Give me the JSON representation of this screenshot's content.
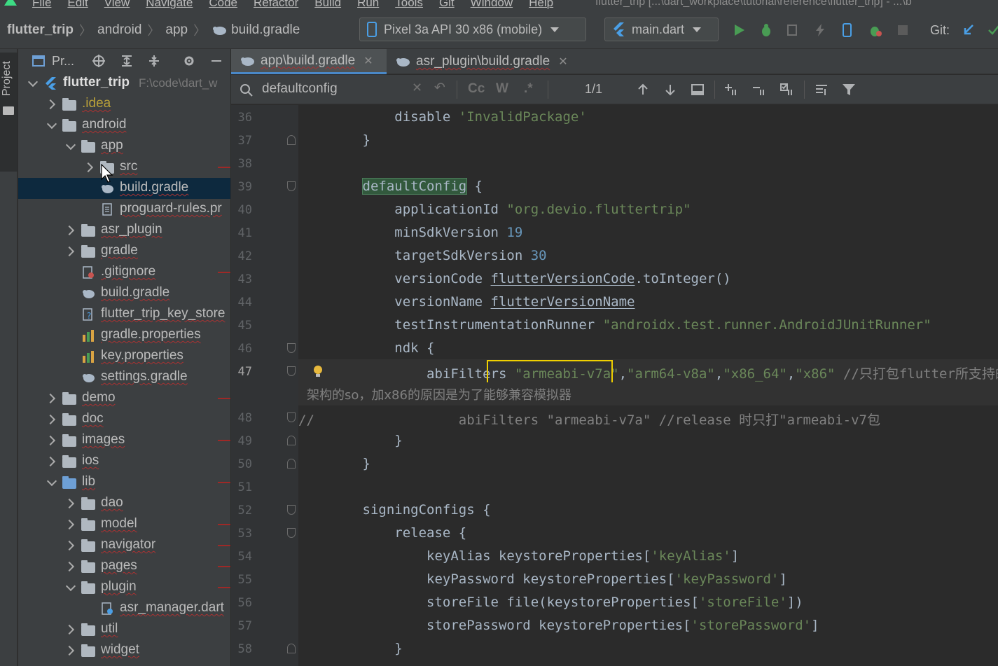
{
  "menubar": {
    "items": [
      "File",
      "Edit",
      "View",
      "Navigate",
      "Code",
      "Refactor",
      "Build",
      "Run",
      "Tools",
      "Git",
      "Window",
      "Help"
    ],
    "window_title": "flutter_trip [...\\dart_workplace\\tutorial\\reference\\flutter_trip] - ...\\b"
  },
  "navbar": {
    "breadcrumb": [
      "flutter_trip",
      "android",
      "app",
      "build.gradle"
    ],
    "device": "Pixel 3a API 30 x86 (mobile)",
    "run_config": "main.dart",
    "git_label": "Git:"
  },
  "toolstrip": {
    "project_tab": "Project"
  },
  "project_panel": {
    "view_label": "Pr...",
    "tree": [
      {
        "label": "flutter_trip",
        "path": "F:\\code\\dart_w",
        "depth": 0,
        "expand": "down",
        "icon": "flutter-project-icon"
      },
      {
        "label": ".idea",
        "depth": 1,
        "expand": "right",
        "icon": "folder-icon"
      },
      {
        "label": "android",
        "depth": 1,
        "expand": "down",
        "icon": "folder-icon"
      },
      {
        "label": "app",
        "depth": 2,
        "expand": "down",
        "icon": "folder-icon"
      },
      {
        "label": "src",
        "depth": 3,
        "expand": "right",
        "icon": "folder-icon"
      },
      {
        "label": "build.gradle",
        "depth": 3,
        "expand": "none",
        "icon": "gradle-icon",
        "selected": true
      },
      {
        "label": "proguard-rules.pr",
        "depth": 3,
        "expand": "none",
        "icon": "file-icon"
      },
      {
        "label": "asr_plugin",
        "depth": 2,
        "expand": "right",
        "icon": "folder-icon"
      },
      {
        "label": "gradle",
        "depth": 2,
        "expand": "right",
        "icon": "folder-icon"
      },
      {
        "label": ".gitignore",
        "depth": 2,
        "expand": "none",
        "icon": "gitignore-icon"
      },
      {
        "label": "build.gradle",
        "depth": 2,
        "expand": "none",
        "icon": "gradle-icon"
      },
      {
        "label": "flutter_trip_key_store",
        "depth": 2,
        "expand": "none",
        "icon": "keystore-icon"
      },
      {
        "label": "gradle.properties",
        "depth": 2,
        "expand": "none",
        "icon": "properties-icon"
      },
      {
        "label": "key.properties",
        "depth": 2,
        "expand": "none",
        "icon": "properties-icon"
      },
      {
        "label": "settings.gradle",
        "depth": 2,
        "expand": "none",
        "icon": "gradle-icon"
      },
      {
        "label": "demo",
        "depth": 1,
        "expand": "right",
        "icon": "folder-icon"
      },
      {
        "label": "doc",
        "depth": 1,
        "expand": "right",
        "icon": "folder-icon"
      },
      {
        "label": "images",
        "depth": 1,
        "expand": "right",
        "icon": "folder-icon"
      },
      {
        "label": "ios",
        "depth": 1,
        "expand": "right",
        "icon": "folder-icon"
      },
      {
        "label": "lib",
        "depth": 1,
        "expand": "down",
        "icon": "folder-blue-icon"
      },
      {
        "label": "dao",
        "depth": 2,
        "expand": "right",
        "icon": "folder-icon"
      },
      {
        "label": "model",
        "depth": 2,
        "expand": "right",
        "icon": "folder-icon"
      },
      {
        "label": "navigator",
        "depth": 2,
        "expand": "right",
        "icon": "folder-icon"
      },
      {
        "label": "pages",
        "depth": 2,
        "expand": "right",
        "icon": "folder-icon"
      },
      {
        "label": "plugin",
        "depth": 2,
        "expand": "down",
        "icon": "folder-icon"
      },
      {
        "label": "asr_manager.dart",
        "depth": 3,
        "expand": "none",
        "icon": "dart-file-icon"
      },
      {
        "label": "util",
        "depth": 2,
        "expand": "right",
        "icon": "folder-icon"
      },
      {
        "label": "widget",
        "depth": 2,
        "expand": "right",
        "icon": "folder-icon"
      }
    ]
  },
  "tabs": [
    {
      "label": "app\\build.gradle",
      "active": true
    },
    {
      "label": "asr_plugin\\build.gradle",
      "active": false
    }
  ],
  "search": {
    "query": "defaultconfig",
    "options": [
      "Cc",
      "W",
      ".*"
    ],
    "match_count": "1/1"
  },
  "editor": {
    "lines": [
      {
        "n": "36",
        "segs": [
          [
            "kw",
            "            disable "
          ],
          [
            "str",
            "'InvalidPackage'"
          ]
        ]
      },
      {
        "n": "37",
        "segs": [
          [
            "kw",
            "        }"
          ]
        ]
      },
      {
        "n": "38",
        "segs": []
      },
      {
        "n": "39",
        "segs": [
          [
            "kw",
            "        "
          ],
          [
            "hl",
            "defaultConfig"
          ],
          [
            "kw",
            " {"
          ]
        ]
      },
      {
        "n": "40",
        "segs": [
          [
            "kw",
            "            applicationId "
          ],
          [
            "str",
            "\"org.devio.fluttertrip\""
          ]
        ]
      },
      {
        "n": "41",
        "segs": [
          [
            "kw",
            "            minSdkVersion "
          ],
          [
            "num",
            "19"
          ]
        ]
      },
      {
        "n": "42",
        "segs": [
          [
            "kw",
            "            targetSdkVersion "
          ],
          [
            "num",
            "30"
          ]
        ]
      },
      {
        "n": "43",
        "segs": [
          [
            "kw",
            "            versionCode "
          ],
          [
            "u",
            "flutterVersionCode"
          ],
          [
            "kw",
            ".toInteger()"
          ]
        ]
      },
      {
        "n": "44",
        "segs": [
          [
            "kw",
            "            versionName "
          ],
          [
            "u",
            "flutterVersionName"
          ]
        ]
      },
      {
        "n": "45",
        "segs": [
          [
            "kw",
            "            testInstrumentationRunner "
          ],
          [
            "str",
            "\"androidx.test.runner.AndroidJUnitRunner\""
          ]
        ]
      },
      {
        "n": "46",
        "segs": [
          [
            "kw",
            "            ndk {"
          ]
        ]
      },
      {
        "n": "47",
        "segs": [
          [
            "kw",
            "                abiFilters "
          ],
          [
            "str",
            "\"armeabi-v7a\""
          ],
          [
            "kw",
            ","
          ],
          [
            "str",
            "\"arm64-v8a\""
          ],
          [
            "kw",
            ","
          ],
          [
            "str",
            "\"x86_64\""
          ],
          [
            "kw",
            ","
          ],
          [
            "str",
            "\"x86\""
          ],
          [
            "cmt",
            " //只打包flutter所支持的"
          ]
        ]
      },
      {
        "n": "",
        "wrap": "架构的so，加x86的原因是为了能够兼容模拟器"
      },
      {
        "n": "48",
        "segs": [
          [
            "cmt",
            "//                  abiFilters \"armeabi-v7a\" //release 时只打\"armeabi-v7包"
          ]
        ]
      },
      {
        "n": "49",
        "segs": [
          [
            "kw",
            "            }"
          ]
        ]
      },
      {
        "n": "50",
        "segs": [
          [
            "kw",
            "        }"
          ]
        ]
      },
      {
        "n": "51",
        "segs": []
      },
      {
        "n": "52",
        "segs": [
          [
            "kw",
            "        signingConfigs {"
          ]
        ]
      },
      {
        "n": "53",
        "segs": [
          [
            "kw",
            "            release {"
          ]
        ]
      },
      {
        "n": "54",
        "segs": [
          [
            "kw",
            "                keyAlias keystoreProperties["
          ],
          [
            "str",
            "'keyAlias'"
          ],
          [
            "kw",
            "]"
          ]
        ]
      },
      {
        "n": "55",
        "segs": [
          [
            "kw",
            "                keyPassword keystoreProperties["
          ],
          [
            "str",
            "'keyPassword'"
          ],
          [
            "kw",
            "]"
          ]
        ]
      },
      {
        "n": "56",
        "segs": [
          [
            "kw",
            "                storeFile file(keystoreProperties["
          ],
          [
            "str",
            "'storeFile'"
          ],
          [
            "kw",
            "])"
          ]
        ]
      },
      {
        "n": "57",
        "segs": [
          [
            "kw",
            "                storePassword keystoreProperties["
          ],
          [
            "str",
            "'storePassword'"
          ],
          [
            "kw",
            "]"
          ]
        ]
      },
      {
        "n": "58",
        "segs": [
          [
            "kw",
            "            }"
          ]
        ]
      }
    ]
  },
  "colors": {
    "accent": "#4a88c7",
    "highlight_box": "#f0d000",
    "string": "#6a8759",
    "number": "#6897bb",
    "run_green": "#499c54"
  }
}
